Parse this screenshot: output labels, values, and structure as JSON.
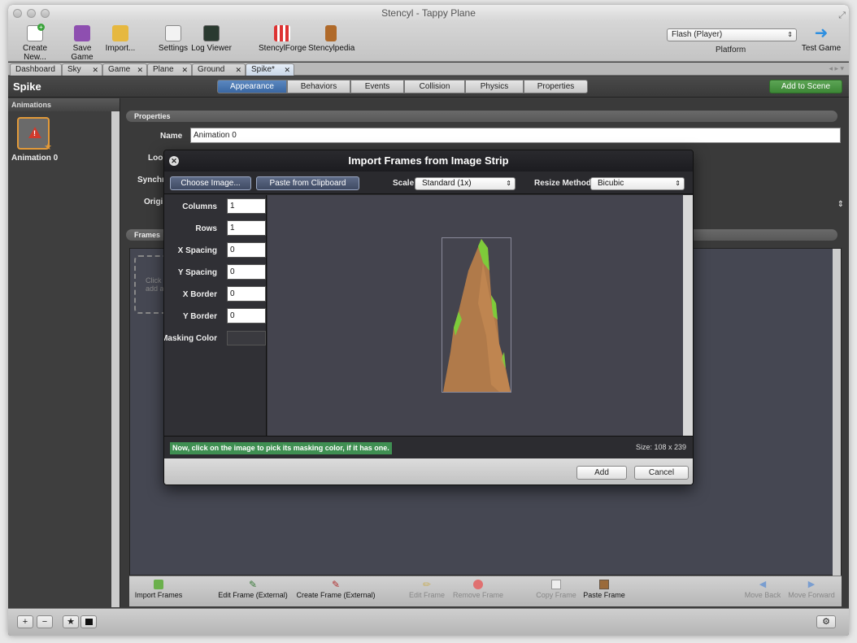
{
  "window": {
    "title": "Stencyl - Tappy Plane"
  },
  "toolbar": {
    "buttons": [
      {
        "label": "Create New...",
        "icon": "plus-icon"
      },
      {
        "label": "Save Game",
        "icon": "save-icon"
      },
      {
        "label": "Import...",
        "icon": "import-icon"
      },
      {
        "label": "Settings",
        "icon": "settings-icon"
      },
      {
        "label": "Log Viewer",
        "icon": "log-viewer-icon"
      },
      {
        "label": "StencylForge",
        "icon": "stencylforge-icon"
      },
      {
        "label": "Stencylpedia",
        "icon": "stencylpedia-icon"
      }
    ],
    "platform_value": "Flash (Player)",
    "platform_label": "Platform",
    "test_game_label": "Test Game"
  },
  "tabs": [
    "Dashboard",
    "Sky",
    "Game",
    "Plane",
    "Ground",
    "Spike*"
  ],
  "header": {
    "title": "Spike",
    "segments": [
      "Appearance",
      "Behaviors",
      "Events",
      "Collision",
      "Physics",
      "Properties"
    ],
    "active_segment": "Appearance",
    "add_to_scene": "Add to Scene"
  },
  "left_panel": {
    "header": "Animations",
    "animation_label": "Animation 0"
  },
  "main": {
    "properties_header": "Properties",
    "name_label": "Name",
    "name_value": "Animation 0",
    "loop_label": "Loop",
    "synchron_label": "Synchron",
    "origin_label": "Origin I",
    "frames_header": "Frames",
    "click_hint_1": "Click",
    "click_hint_2": "add a"
  },
  "bottom_bar": {
    "import_frames": "Import Frames",
    "edit_frame_external": "Edit Frame (External)",
    "create_frame_external": "Create Frame (External)",
    "edit_frame": "Edit Frame",
    "remove_frame": "Remove Frame",
    "copy_frame": "Copy Frame",
    "paste_frame": "Paste Frame",
    "move_back": "Move Back",
    "move_forward": "Move Forward"
  },
  "dialog": {
    "title": "Import Frames from Image Strip",
    "choose_image": "Choose Image...",
    "paste_clipboard": "Paste from Clipboard",
    "scale_label": "Scale",
    "scale_value": "Standard (1x)",
    "resize_label": "Resize Method",
    "resize_value": "Bicubic",
    "fields": {
      "columns_label": "Columns",
      "columns_value": "1",
      "rows_label": "Rows",
      "rows_value": "1",
      "xspacing_label": "X Spacing",
      "xspacing_value": "0",
      "yspacing_label": "Y Spacing",
      "yspacing_value": "0",
      "xborder_label": "X Border",
      "xborder_value": "0",
      "yborder_label": "Y Border",
      "yborder_value": "0",
      "masking_label": "Masking Color"
    },
    "hint": "Now, click on the image to pick its masking color, if it has one.",
    "size": "Size: 108 x 239",
    "add": "Add",
    "cancel": "Cancel"
  }
}
